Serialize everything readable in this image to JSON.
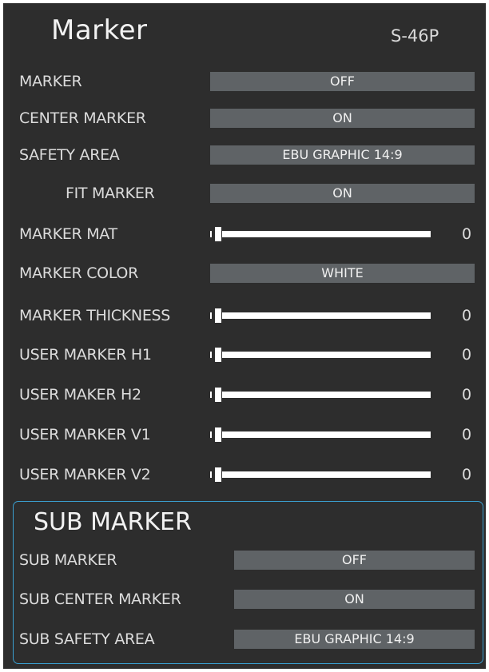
{
  "header": {
    "title": "Marker",
    "model": "S-46P"
  },
  "settings": {
    "marker": {
      "label": "MARKER",
      "value": "OFF"
    },
    "center_marker": {
      "label": "CENTER MARKER",
      "value": "ON"
    },
    "safety_area": {
      "label": "SAFETY AREA",
      "value": "EBU GRAPHIC 14:9"
    },
    "fit_marker": {
      "label": "FIT MARKER",
      "value": "ON"
    },
    "marker_mat": {
      "label": "MARKER MAT",
      "value": "0"
    },
    "marker_color": {
      "label": "MARKER COLOR",
      "value": "WHITE"
    },
    "marker_thickness": {
      "label": "MARKER THICKNESS",
      "value": "0"
    },
    "user_marker_h1": {
      "label": "USER MARKER H1",
      "value": "0"
    },
    "user_maker_h2": {
      "label": "USER MAKER H2",
      "value": "0"
    },
    "user_marker_v1": {
      "label": "USER MARKER V1",
      "value": "0"
    },
    "user_marker_v2": {
      "label": "USER MARKER V2",
      "value": "0"
    }
  },
  "sub_marker": {
    "title": "SUB MARKER",
    "items": {
      "sub_marker": {
        "label": "SUB MARKER",
        "value": "OFF"
      },
      "sub_center_marker": {
        "label": "SUB CENTER MARKER",
        "value": "ON"
      },
      "sub_safety_area": {
        "label": "SUB SAFETY AREA",
        "value": "EBU GRAPHIC 14:9"
      }
    }
  },
  "colors": {
    "panel_bg": "#2d2d2d",
    "value_box": "#5f6366",
    "sub_border": "#3a9fd0",
    "slider": "#ffffff"
  }
}
